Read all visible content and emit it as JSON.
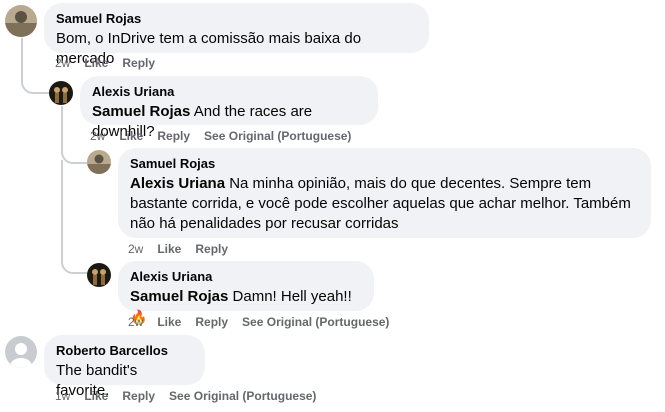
{
  "comments": [
    {
      "author": "Samuel Rojas",
      "text": "Bom, o InDrive tem a comissão mais baixa do mercado",
      "time": "2w",
      "like": "Like",
      "reply": "Reply"
    },
    {
      "author": "Alexis Uriana",
      "mention": "Samuel Rojas",
      "text": "And the races are downhill?",
      "time": "2w",
      "like": "Like",
      "reply": "Reply",
      "see_original": "See Original (Portuguese)"
    },
    {
      "author": "Samuel Rojas",
      "mention": "Alexis Uriana",
      "text_line1": "Na minha opinião, mais do que decentes. Sempre tem",
      "text_line2": "bastante corrida, e você pode escolher aquelas que achar melhor. Também",
      "text_line3": "não há penalidades por recusar corridas",
      "time": "2w",
      "like": "Like",
      "reply": "Reply"
    },
    {
      "author": "Alexis Uriana",
      "mention": "Samuel Rojas",
      "text": "Damn! Hell yeah!!",
      "emoji": "🔥",
      "time": "2w",
      "like": "Like",
      "reply": "Reply",
      "see_original": "See Original (Portuguese)"
    },
    {
      "author": "Roberto Barcellos",
      "text": "The bandit's favorite.",
      "time": "1w",
      "like": "Like",
      "reply": "Reply",
      "see_original": "See Original (Portuguese)"
    }
  ]
}
